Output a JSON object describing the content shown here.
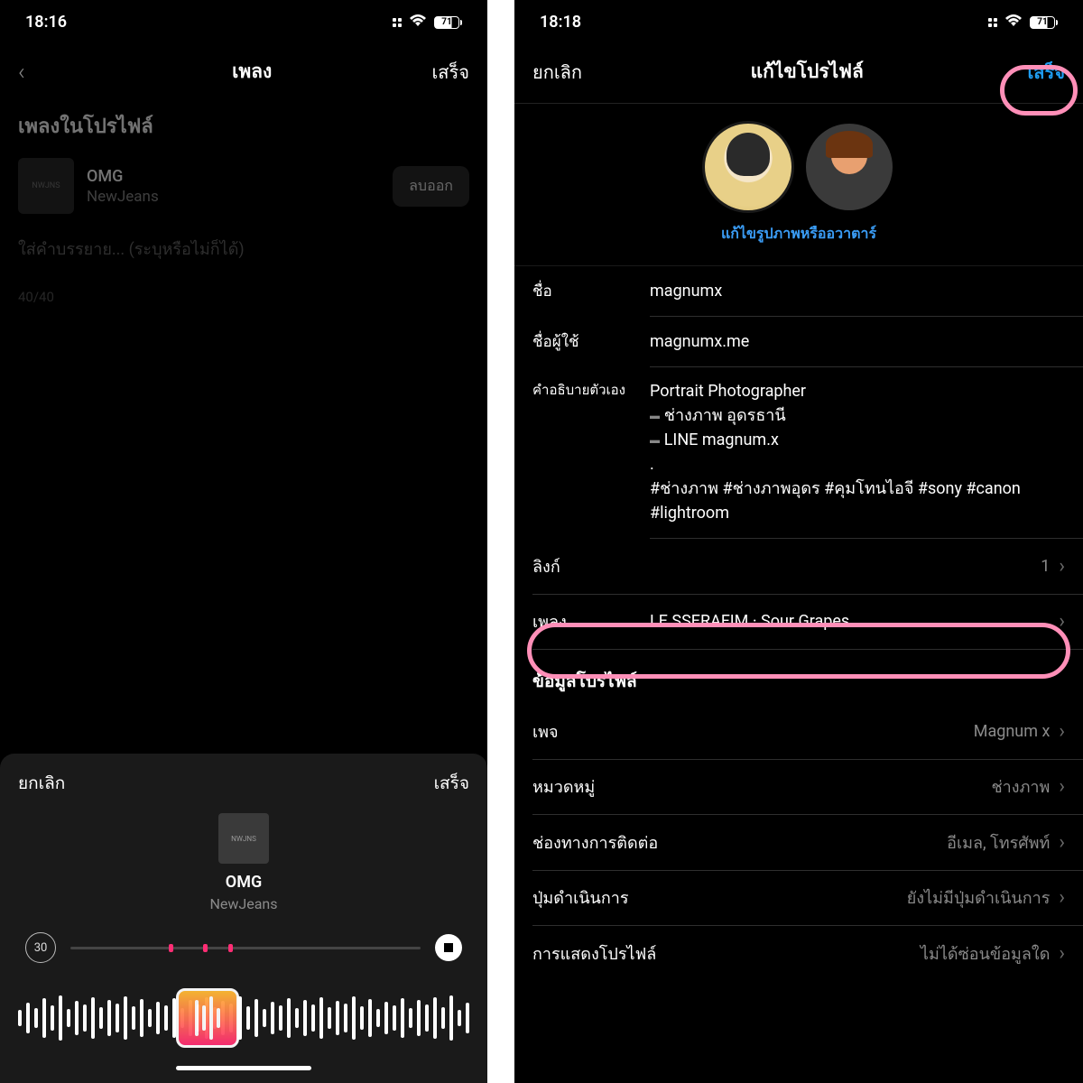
{
  "left": {
    "status": {
      "time": "18:16",
      "battery": "71"
    },
    "nav": {
      "title": "เพลง",
      "done": "เสร็จ"
    },
    "section_title": "เพลงในโปรไฟล์",
    "song": {
      "title": "OMG",
      "artist": "NewJeans",
      "art_text": "NWJNS"
    },
    "remove_btn": "ลบออก",
    "caption_placeholder": "ใส่คำบรรยาย... (ระบุหรือไม่ก็ได้)",
    "char_count": "40/40",
    "sheet": {
      "cancel": "ยกเลิก",
      "done": "เสร็จ",
      "title": "OMG",
      "artist": "NewJeans",
      "duration_badge": "30"
    }
  },
  "right": {
    "status": {
      "time": "18:18",
      "battery": "71"
    },
    "nav": {
      "cancel": "ยกเลิก",
      "title": "แก้ไขโปรไฟล์",
      "done": "เสร็จ"
    },
    "edit_pic": "แก้ไขรูปภาพหรืออวาตาร์",
    "fields": {
      "name_label": "ชื่อ",
      "name_value": "magnumx",
      "username_label": "ชื่อผู้ใช้",
      "username_value": "magnumx.me",
      "bio_label": "คำอธิบายตัวเอง",
      "bio_line1": "Portrait Photographer",
      "bio_line2": "ช่างภาพ อุดรธานี",
      "bio_line3": "LINE magnum.x",
      "bio_dot": ".",
      "bio_tags": "#ช่างภาพ #ช่างภาพอุดร #คุมโทนไอจี #sony #canon #lightroom",
      "link_label": "ลิงก์",
      "link_count": "1",
      "music_label": "เพลง",
      "music_value": "LE SSERAFIM · Sour Grapes"
    },
    "profile_info_header": "ข้อมูลโปรไฟล์",
    "rows": {
      "page_label": "เพจ",
      "page_value": "Magnum x",
      "category_label": "หมวดหมู่",
      "category_value": "ช่างภาพ",
      "contact_label": "ช่องทางการติดต่อ",
      "contact_value": "อีเมล, โทรศัพท์",
      "action_label": "ปุ่มดำเนินการ",
      "action_value": "ยังไม่มีปุ่มดำเนินการ",
      "display_label": "การแสดงโปรไฟล์",
      "display_value": "ไม่ได้ซ่อนข้อมูลใด"
    }
  }
}
